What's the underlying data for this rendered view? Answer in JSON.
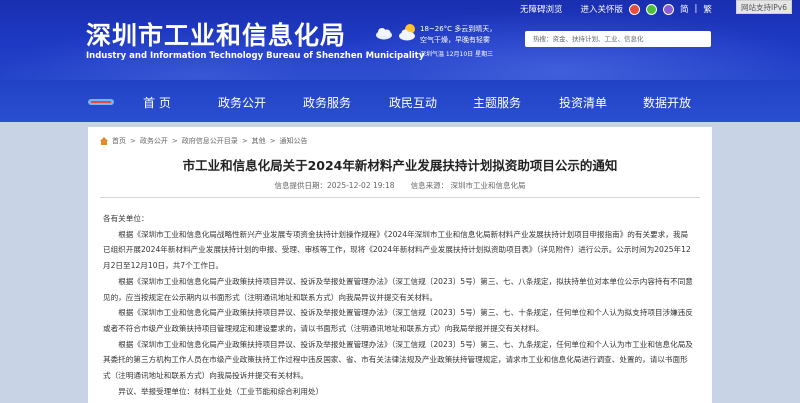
{
  "header": {
    "title": "深圳市工业和信息化局",
    "subtitle": "Industry and Information Technology Bureau of Shenzhen Municipality",
    "top_links": [
      "无障碍浏览",
      "进入关怀版",
      "简",
      "繁"
    ],
    "ipv6": "网站支持IPv6",
    "weather": {
      "text": "18~26°C  多云到晴天，空气干燥，早晚有轻雾",
      "date": "深圳气温  12月10日  星期三"
    },
    "search_placeholder": "热搜：资金、扶持计划、工业、信息化"
  },
  "nav": {
    "items": [
      "首 页",
      "政务公开",
      "政务服务",
      "政民互动",
      "主题服务",
      "投资清单",
      "数据开放"
    ]
  },
  "breadcrumb": [
    "首页",
    "政务公开",
    "政府信息公开目录",
    "其他",
    "通知公告"
  ],
  "article": {
    "title": "市工业和信息化局关于2024年新材料产业发展扶持计划拟资助项目公示的通知",
    "meta_date": "信息提供日期：2025-12-02 19:18",
    "meta_source": "信息来源：  深圳市工业和信息化局",
    "paragraphs": [
      "各有关单位：",
      "根据《深圳市工业和信息化局战略性新兴产业发展专项资金扶持计划操作规程》《2024年深圳市工业和信息化局新材料产业发展扶持计划项目申报指南》的有关要求，我局已组织开展2024年新材料产业发展扶持计划的申报、受理、审核等工作，现将《2024年新材料产业发展扶持计划拟资助项目表》（详见附件）进行公示。公示时间为2025年12月2日至12月10日，共7个工作日。",
      "根据《深圳市工业和信息化局产业政策扶持项目异议、投诉及举报处置管理办法》（深工信规〔2023〕5号）第三、七、八条规定，拟扶持单位对本单位公示内容持有不同意见的，应当按规定在公示期内以书面形式（注明通讯地址和联系方式）向我局异议并提交有关材料。",
      "根据《深圳市工业和信息化局产业政策扶持项目异议、投诉及举报处置管理办法》（深工信规〔2023〕5号）第三、七、十条规定，任何单位和个人认为拟支持项目涉嫌违反或者不符合市级产业政策扶持项目管理规定和建设要求的，请以书面形式（注明通讯地址和联系方式）向我局举报并提交有关材料。",
      "根据《深圳市工业和信息化局产业政策扶持项目异议、投诉及举报处置管理办法》（深工信规〔2023〕5号）第三、七、九条规定，任何单位和个人认为市工业和信息化局及其委托的第三方机构工作人员在市级产业政策扶持工作过程中违反国家、省、市有关法律法规及产业政策扶持管理规定，请求市工业和信息化局进行调查、处置的，请以书面形式（注明通讯地址和联系方式）向我局投诉并提交有关材料。",
      "异议、举报受理单位：材料工业处（工业节能和综合利用处）"
    ]
  },
  "colors": {
    "header_bg": "#1e3ac4",
    "nav_bg": "#2a4fd0",
    "page_bg": "#c9d3e6"
  }
}
